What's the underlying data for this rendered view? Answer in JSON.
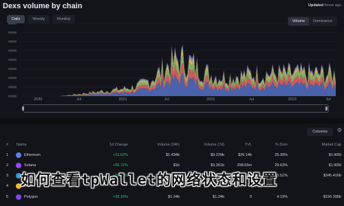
{
  "header": {
    "title": "Dexs volume by chain",
    "updated_label": "Updated",
    "updated_value": "hours ago"
  },
  "range_buttons": [
    "Daily",
    "Weekly",
    "Monthly"
  ],
  "view_toggle": [
    "Volume",
    "Dominance"
  ],
  "chart_data": {
    "type": "area",
    "x_ticks": [
      "2020",
      "Jul",
      "2021",
      "Jul",
      "2022",
      "Jul",
      "2023",
      "Jul"
    ],
    "y_ticks": [
      "",
      "",
      "",
      "",
      "",
      "",
      "",
      "",
      ""
    ],
    "series_colors": [
      "#5470c6",
      "#ee6666",
      "#91cc75",
      "#fac858",
      "#73c0de",
      "#9a60b4"
    ]
  },
  "table": {
    "columns_button": "Columns",
    "headers": [
      "#",
      "Name",
      "1d Change",
      "Volume (24h)",
      "Volume (7d)",
      "TVL",
      "% Dom",
      "Market Cap"
    ],
    "rows": [
      {
        "rank": "1",
        "name": "Ethereum",
        "change": "+21.62%",
        "v24": "$1.434b",
        "v7d": "$9.229b",
        "tvl": "$26.14b",
        "dom": "25.39%",
        "mc": "$1.905t",
        "color": "#627eea"
      },
      {
        "rank": "2",
        "name": "Solana",
        "change": "+65.72%",
        "v24": "$1b",
        "v7d": "$3.351b",
        "tvl": "298.65m",
        "dom": "29.63%",
        "mc": "$1.905t",
        "color": "#9945ff"
      },
      {
        "rank": "3",
        "name": "Arbitrum",
        "change": "+60.34%",
        "v24": "$1.1b",
        "v7d": "$4.8b",
        "tvl": "$3.04b",
        "dom": "5.51%",
        "mc": "$345.416b",
        "color": "#2d9cdb"
      },
      {
        "rank": "4",
        "name": "BSC",
        "change": "",
        "v24": "",
        "v7d": "",
        "tvl": "",
        "dom": "",
        "mc": "",
        "color": "#f3ba2f"
      },
      {
        "rank": "5",
        "name": "Polygon",
        "change": "+36.16%",
        "v24": "$1.24b",
        "v7d": "$1.24b",
        "tvl": "0",
        "dom": "4.19%",
        "mc": "$156.395b",
        "color": "#8247e5"
      }
    ]
  },
  "overlay_text": "如何查看tpWallet的网络状态和设置"
}
